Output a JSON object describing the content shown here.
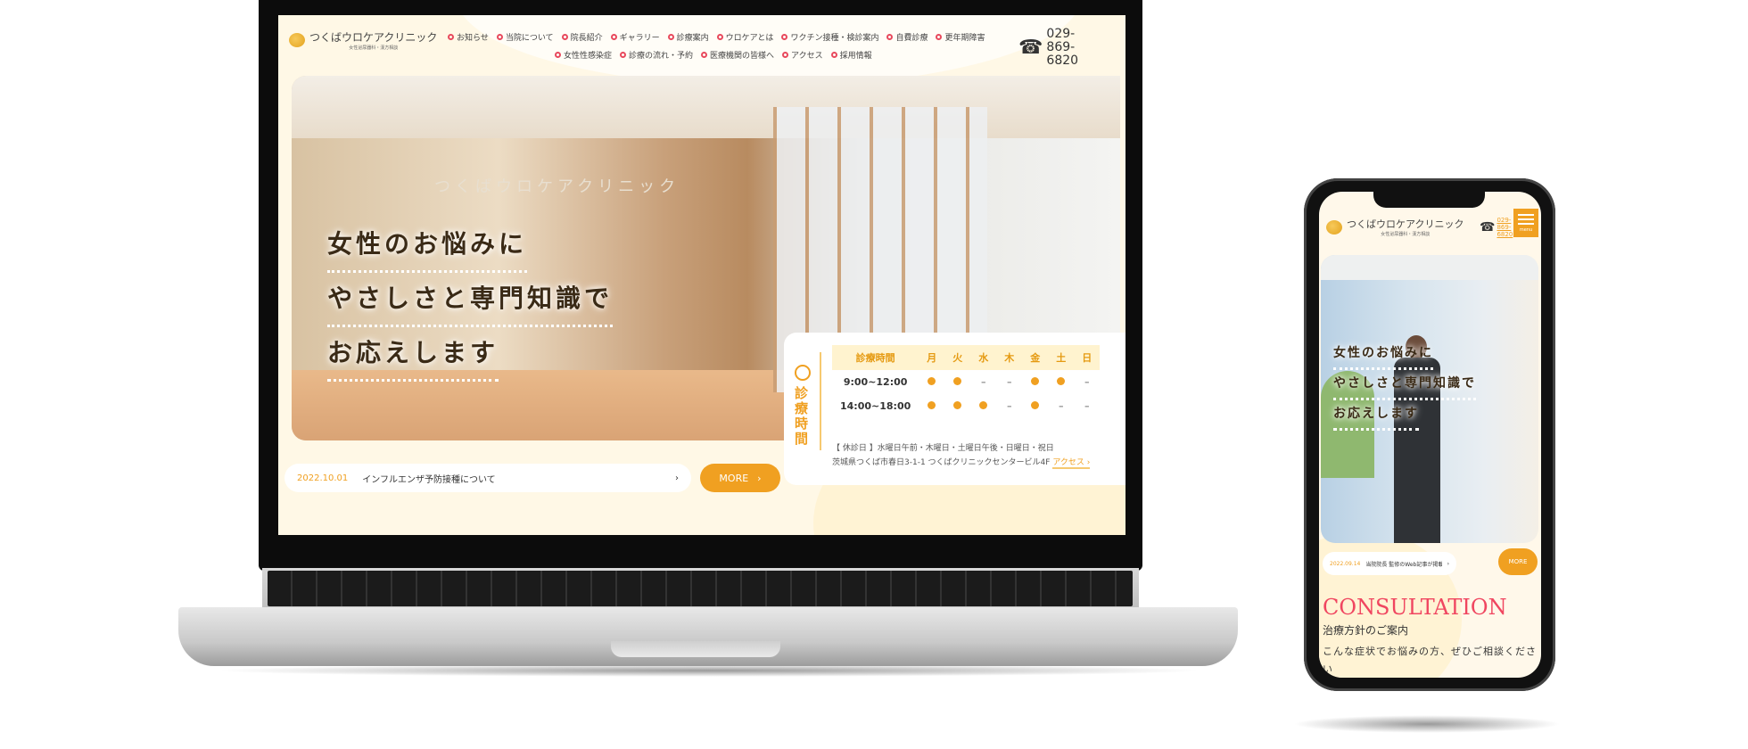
{
  "laptop": {
    "logo": {
      "name": "つくばウロケアクリニック",
      "sub": "女性泌尿器科・漢方相談"
    },
    "nav_row1": [
      "お知らせ",
      "当院について",
      "院長紹介",
      "ギャラリー",
      "診療案内",
      "ウロケアとは",
      "ワクチン接種・検診案内",
      "自費診療",
      "更年期障害"
    ],
    "nav_row2": [
      "女性性感染症",
      "診療の流れ・予約",
      "医療機関の皆様へ",
      "アクセス",
      "採用情報"
    ],
    "tel": [
      "029-",
      "869-",
      "6820"
    ],
    "sign": "つくばウロケアクリニック",
    "headline": [
      "女性のお悩みに",
      "やさしさと専門知識で",
      "お応えします"
    ],
    "schedule": {
      "title": "診療時間",
      "header": [
        "診療時間",
        "月",
        "火",
        "水",
        "木",
        "金",
        "土",
        "日"
      ],
      "rows": [
        {
          "time": "9:00~12:00",
          "days": [
            true,
            true,
            false,
            false,
            true,
            true,
            false
          ]
        },
        {
          "time": "14:00~18:00",
          "days": [
            true,
            true,
            true,
            false,
            true,
            false,
            false
          ]
        }
      ],
      "closed": "【 休診日 】水曜日午前・木曜日・土曜日午後・日曜日・祝日",
      "address": "茨城県つくば市春日3-1-1 つくばクリニックセンタービル4F",
      "access": "アクセス ›"
    },
    "news": {
      "date": "2022.10.01",
      "title": "インフルエンザ予防接種について",
      "arrow": "›"
    },
    "more": "MORE",
    "more_arrow": "›"
  },
  "phone": {
    "logo": {
      "name": "つくばウロケアクリニック",
      "sub": "女性泌尿器科・漢方相談"
    },
    "tel": [
      "029-",
      "869-",
      "6820"
    ],
    "menu": "menu",
    "headline": [
      "女性のお悩みに",
      "やさしさと専門知識で",
      "お応えします"
    ],
    "news": {
      "date": "2022.09.14",
      "title": "当院院長 監修のWeb記事が掲載…",
      "arrow": "›"
    },
    "more": "MORE",
    "section_en": "CONSULTATION",
    "section_ja": "治療方針のご案内",
    "lead": "こんな症状でお悩みの方、ぜひご相談ください"
  },
  "colors": {
    "accent": "#f0a021",
    "nav_ring": "#e8495d",
    "consultation": "#f04660",
    "background": "#fff8e6"
  }
}
